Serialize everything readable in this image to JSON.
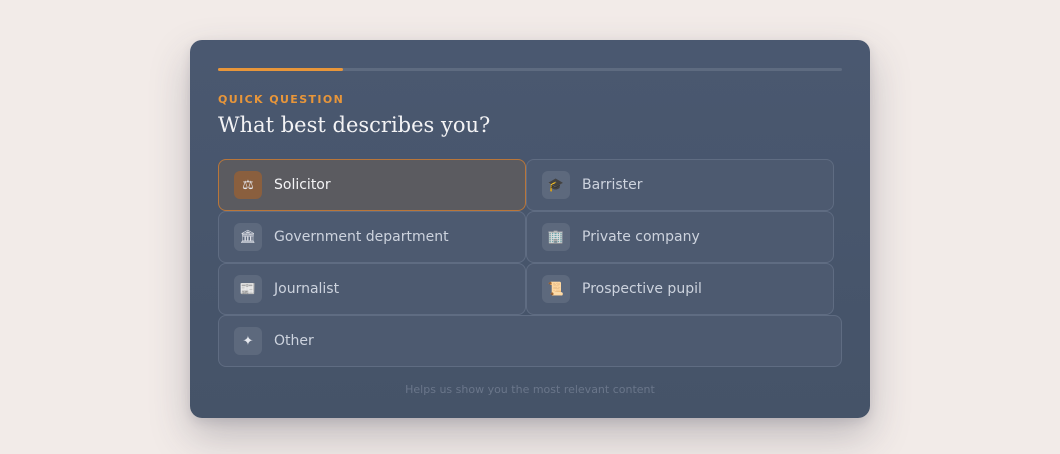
{
  "progress": {
    "fraction": 0.2
  },
  "eyebrow": "QUICK QUESTION",
  "question": "What best describes you?",
  "options": [
    {
      "label": "Solicitor",
      "icon": "scales-icon",
      "glyph": "⚖",
      "selected": true
    },
    {
      "label": "Barrister",
      "icon": "graduation-cap-icon",
      "glyph": "🎓",
      "selected": false
    },
    {
      "label": "Government department",
      "icon": "classical-building-icon",
      "glyph": "🏛",
      "selected": false
    },
    {
      "label": "Private company",
      "icon": "office-building-icon",
      "glyph": "🏢",
      "selected": false
    },
    {
      "label": "Journalist",
      "icon": "newspaper-icon",
      "glyph": "📰",
      "selected": false
    },
    {
      "label": "Prospective pupil",
      "icon": "scroll-icon",
      "glyph": "📜",
      "selected": false
    },
    {
      "label": "Other",
      "icon": "sparkle-icon",
      "glyph": "✦",
      "selected": false
    }
  ],
  "footnote": "Helps us show you the most relevant content",
  "colors": {
    "accent": "#e8963a",
    "card": "#4a5870",
    "background": "#f2ebe8"
  }
}
